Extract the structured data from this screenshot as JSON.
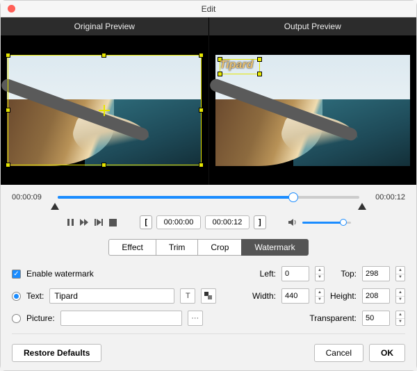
{
  "window": {
    "title": "Edit"
  },
  "preview": {
    "original_label": "Original Preview",
    "output_label": "Output Preview",
    "watermark_text": "Tipard"
  },
  "timeline": {
    "current": "00:00:09",
    "total": "00:00:12",
    "progress_pct": 78
  },
  "transport": {
    "range_start": "00:00:00",
    "range_end": "00:00:12"
  },
  "tabs": {
    "effect": "Effect",
    "trim": "Trim",
    "crop": "Crop",
    "watermark": "Watermark",
    "active": "watermark"
  },
  "watermark": {
    "enable_label": "Enable watermark",
    "enabled": true,
    "mode": "text",
    "text_label": "Text:",
    "text_value": "Tipard",
    "picture_label": "Picture:",
    "picture_value": "",
    "left_label": "Left:",
    "left": "0",
    "top_label": "Top:",
    "top": "298",
    "width_label": "Width:",
    "width": "440",
    "height_label": "Height:",
    "height": "208",
    "transparent_label": "Transparent:",
    "transparent": "50"
  },
  "buttons": {
    "restore": "Restore Defaults",
    "cancel": "Cancel",
    "ok": "OK"
  }
}
